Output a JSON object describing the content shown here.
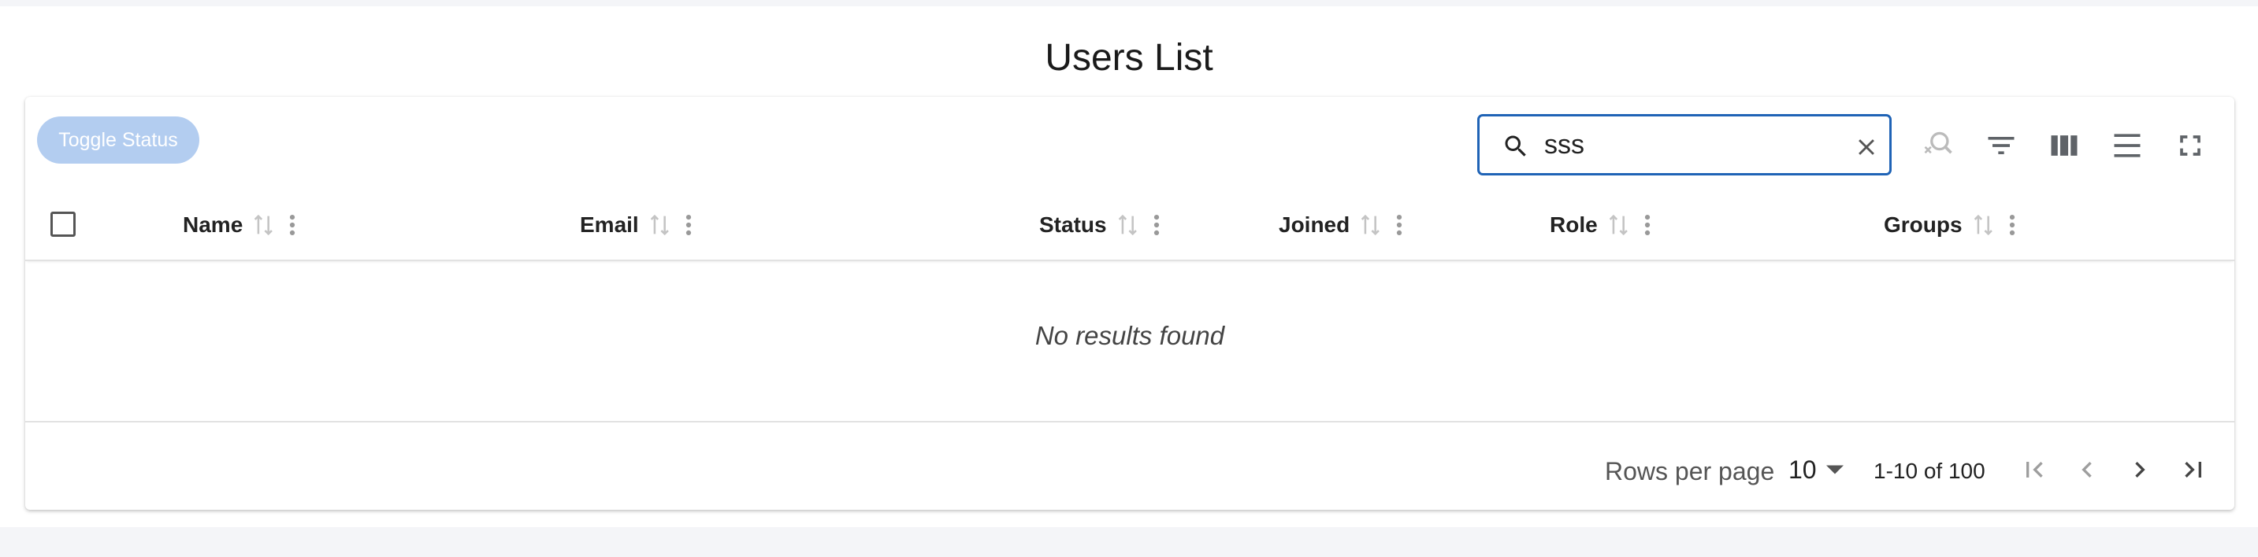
{
  "page": {
    "title": "Users List"
  },
  "toolbar": {
    "toggle_status_label": "Toggle Status",
    "search_value": "sss",
    "icons": [
      "search-icon",
      "clear-icon",
      "clear-search-icon",
      "filter-icon",
      "columns-icon",
      "density-icon",
      "fullscreen-icon"
    ]
  },
  "table": {
    "columns": [
      {
        "label": "Name"
      },
      {
        "label": "Email"
      },
      {
        "label": "Status"
      },
      {
        "label": "Joined"
      },
      {
        "label": "Role"
      },
      {
        "label": "Groups"
      }
    ],
    "empty_message": "No results found"
  },
  "pagination": {
    "rows_per_page_label": "Rows per page",
    "rows_per_page_value": "10",
    "range_text": "1-10 of 100"
  },
  "colors": {
    "accent": "#1f63b6",
    "toggle_disabled": "#b3cdf0",
    "icon_gray": "#5f6368",
    "sort_icon_gray": "#c4c4c4"
  }
}
